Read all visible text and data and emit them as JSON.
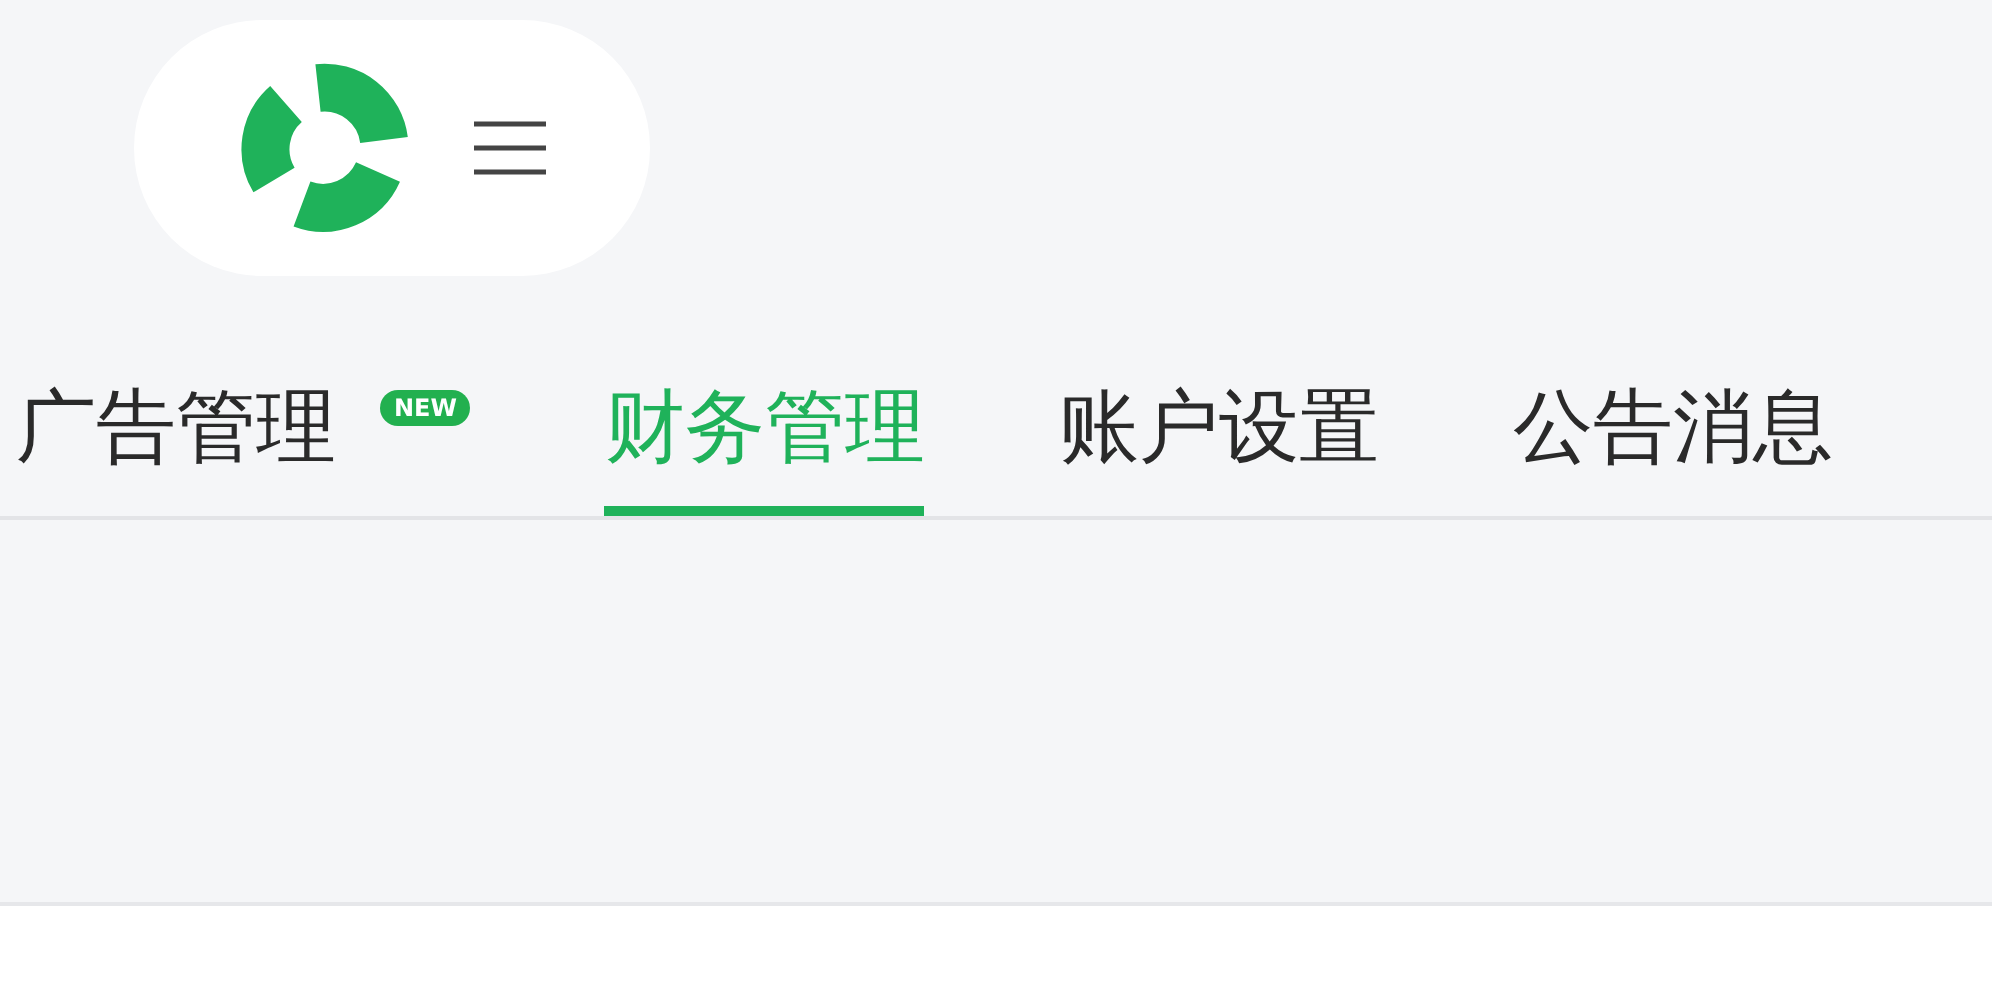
{
  "tabs": [
    {
      "label": "广告管理",
      "badge": "NEW",
      "selected": false
    },
    {
      "label": "财务管理",
      "selected": true
    },
    {
      "label": "账户设置",
      "selected": false
    },
    {
      "label": "公告消息",
      "selected": false
    }
  ]
}
